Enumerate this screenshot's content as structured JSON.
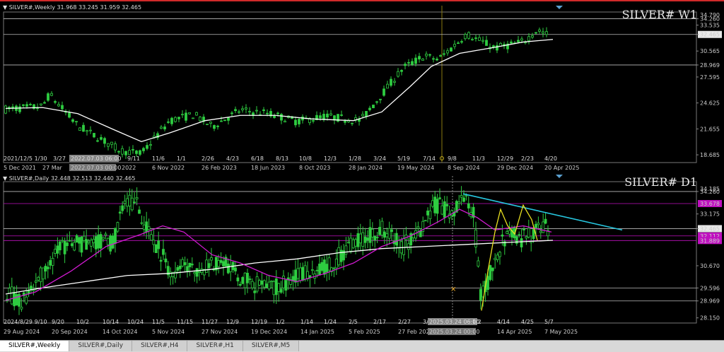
{
  "charts": [
    {
      "id": "w1",
      "header": "SILVER#,Weekly  31.968 33.245 31.959 32.465",
      "watermark": "SILVER# W1",
      "price_axis_labels": [
        "34.260",
        "33.535",
        "32.465",
        "30.565",
        "28.969",
        "27.595",
        "24.625",
        "21.655",
        "18.685"
      ],
      "top_cut_label": "34.790",
      "current_price": "32.465",
      "gridline_prices": [
        "34.260",
        "32.465",
        "28.969"
      ],
      "time_axis_labels": [
        "5 Dec 2021",
        "27 Mar",
        "2022.07.03 00:00",
        "2022",
        "6 Nov 2022",
        "26 Feb 2023",
        "18 Jun 2023",
        "8 Oct 2023",
        "28 Jan 2024",
        "19 May 2024",
        "8 Sep 2024",
        "29 Dec 2024",
        "20 Apr 2025"
      ],
      "inner_date_labels": [
        "2021/12/5|1/30",
        "3/27",
        "2022.07.03 06:00",
        "9/11",
        "11/6",
        "1/1",
        "2/26",
        "4/23",
        "6/18",
        "8/13",
        "10/8",
        "12/3",
        "1/28",
        "3/24",
        "5/19",
        "7/14",
        "9/8",
        "11/3",
        "12/29",
        "2/23",
        "4/20"
      ],
      "ma_color": "#ffffff",
      "candle_color": "#2ecc40",
      "crosshair_color": "#8a7a10"
    },
    {
      "id": "d1",
      "header": "SILVER#,Daily  32.448 32.513 32.440 32.465",
      "watermark": "SILVER# D1",
      "price_axis_labels": [
        "34.260",
        "33.175",
        "32.465",
        "30.670",
        "29.596",
        "28.969",
        "28.150"
      ],
      "top_cut_label": "34.185",
      "magenta_labels": [
        "33.678",
        "32.112",
        "31.889"
      ],
      "current_price": "32.465",
      "time_axis_labels": [
        "29 Aug 2024",
        "20 Sep 2024",
        "14 Oct 2024",
        "5 Nov 2024",
        "27 Nov 2024",
        "19 Dec 2024",
        "14 Jan 2025",
        "5 Feb 2025",
        "27 Feb 2025",
        "2025.03.24 00:00",
        "14 Apr 2025",
        "7 May 2025"
      ],
      "inner_date_labels": [
        "2024/8/29|9/10",
        "9/20",
        "10/2",
        "10/14",
        "10/24",
        "11/5",
        "11/15",
        "11/27",
        "12/9",
        "12/19",
        "1/2",
        "1/14",
        "1/24",
        "2/5",
        "2/17",
        "2/27",
        "3/",
        "2025.03.24 06:00",
        "1/2",
        "4/14",
        "4/25",
        "5/7"
      ],
      "fast_ma_color": "#d01ad0",
      "slow_ma_color": "#ffffff",
      "trendline_color": "#27c7e0",
      "drawing_color": "#e8e020",
      "candle_color": "#2ecc40"
    }
  ],
  "tabs": [
    {
      "label": "SILVER#,Weekly",
      "active": true
    },
    {
      "label": "SILVER#,Daily",
      "active": false
    },
    {
      "label": "SILVER#,H4",
      "active": false
    },
    {
      "label": "SILVER#,H1",
      "active": false
    },
    {
      "label": "SILVER#,M5",
      "active": false
    }
  ]
}
